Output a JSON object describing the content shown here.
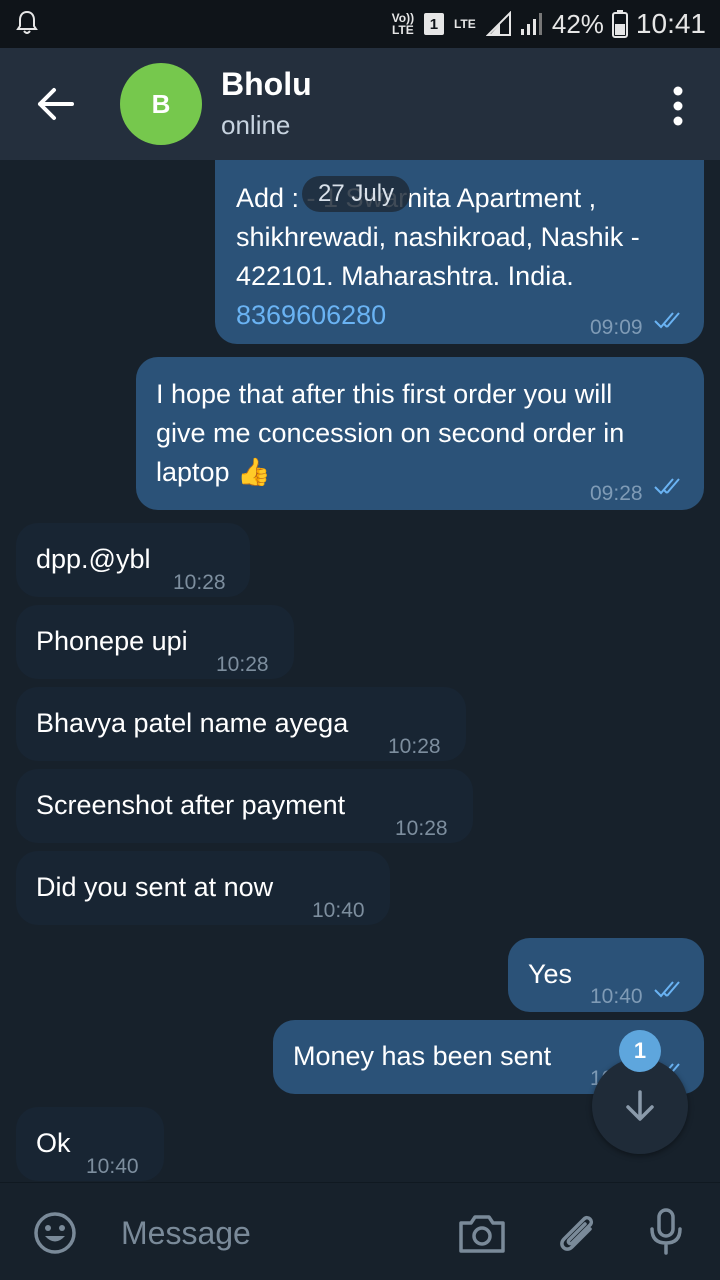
{
  "status_bar": {
    "volte": "Vo)) LTE",
    "sim": "1",
    "lte": "LTE",
    "battery_percent": "42%",
    "time": "10:41"
  },
  "header": {
    "avatar_letter": "B",
    "contact_name": "Bholu",
    "status": "online"
  },
  "chat": {
    "date_chip": "27 July",
    "messages": [
      {
        "dir": "out",
        "lines": [
          "Add : - 1 Swarnita Apartment ,",
          "shikhrewadi, nashikroad, Nashik -",
          "422101. Maharashtra.  India."
        ],
        "link": "8369606280",
        "time": "09:09",
        "read": true
      },
      {
        "dir": "out",
        "lines": [
          "I hope that after this first order you will",
          "give me concession on second order in",
          "laptop 👍"
        ],
        "time": "09:28",
        "read": true
      },
      {
        "dir": "in",
        "text": "dpp.@ybl",
        "time": "10:28"
      },
      {
        "dir": "in",
        "text": "Phonepe upi",
        "time": "10:28"
      },
      {
        "dir": "in",
        "text": "Bhavya patel name ayega",
        "time": "10:28"
      },
      {
        "dir": "in",
        "text": "Screenshot after payment",
        "time": "10:28"
      },
      {
        "dir": "in",
        "text": "Did you sent at now",
        "time": "10:40"
      },
      {
        "dir": "out",
        "text": "Yes",
        "time": "10:40",
        "read": true
      },
      {
        "dir": "out",
        "text": "Money has been sent",
        "time": "10:40",
        "read": true
      },
      {
        "dir": "in",
        "text": "Ok",
        "time": "10:40"
      }
    ]
  },
  "scroll_down": {
    "unread_count": "1"
  },
  "input": {
    "placeholder": "Message"
  },
  "colors": {
    "background": "#17212b",
    "header": "#242f3d",
    "outgoing_bubble": "#2b5278",
    "incoming_bubble": "#182533",
    "accent": "#6ab3f3",
    "avatar": "#76c84d"
  }
}
